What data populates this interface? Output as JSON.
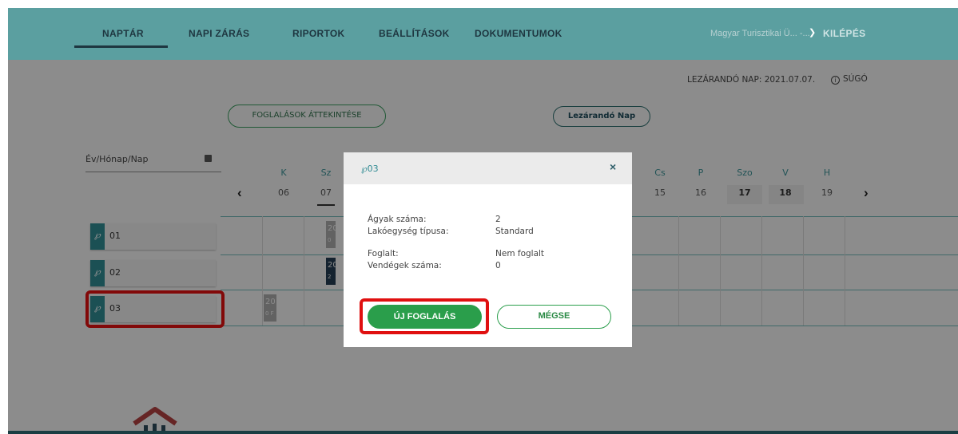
{
  "nav": {
    "items": [
      "NAPTÁR",
      "NAPI ZÁRÁS",
      "RIPORTOK",
      "BEÁLLÍTÁSOK",
      "DOKUMENTUMOK"
    ],
    "user": "Magyar Turisztikai Ü... -...",
    "logout": "KILÉPÉS"
  },
  "header": {
    "closing_day": "LEZÁRANDÓ NAP: 2021.07.07.",
    "help": "SÚGÓ",
    "overview_button": "FOGLALÁSOK ÁTTEKINTÉSE",
    "closing_button": "Lezárandó Nap"
  },
  "calendar": {
    "date_placeholder": "Év/Hónap/Nap",
    "days": [
      {
        "name": "K",
        "num": "06"
      },
      {
        "name": "Sz",
        "num": "07"
      },
      {
        "name": "Cs",
        "num": "15"
      },
      {
        "name": "P",
        "num": "16"
      },
      {
        "name": "Szo",
        "num": "17"
      },
      {
        "name": "V",
        "num": "18"
      },
      {
        "name": "H",
        "num": "19"
      }
    ],
    "rooms": [
      "01",
      "02",
      "03"
    ],
    "bookings": [
      {
        "text": "20",
        "sub": "0"
      },
      {
        "text": "20",
        "sub": "2"
      },
      {
        "text": "20",
        "sub": "0 F"
      }
    ]
  },
  "modal": {
    "title": "03",
    "rows": [
      {
        "label": "Ágyak száma:",
        "value": "2"
      },
      {
        "label": "Lakóegység típusa:",
        "value": "Standard"
      },
      {
        "label": "Foglalt:",
        "value": "Nem foglalt"
      },
      {
        "label": "Vendégek száma:",
        "value": "0"
      }
    ],
    "new_button": "ÚJ FOGLALÁS",
    "cancel_button": "MÉGSE"
  },
  "colors": {
    "nav_bg": "#5b9fa0",
    "accent_teal": "#2f8a92",
    "primary_green": "#2a9e4b",
    "highlight_red": "#e01010"
  }
}
